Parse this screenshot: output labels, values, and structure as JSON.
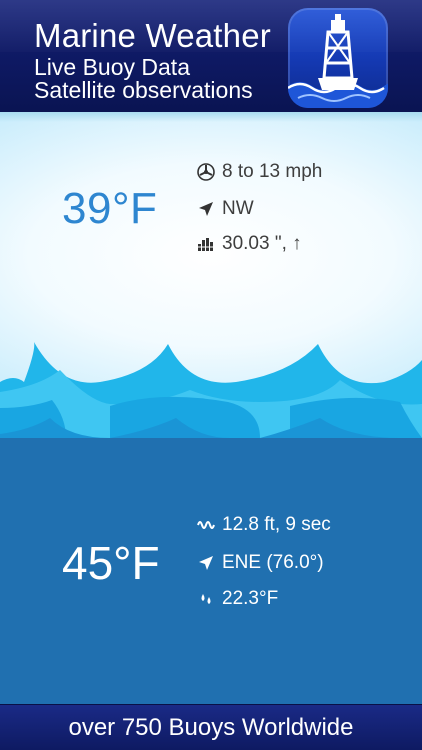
{
  "header": {
    "title": "Marine Weather",
    "subtitle1": "Live Buoy Data",
    "subtitle2": "Satellite observations",
    "app_icon": "buoy-icon"
  },
  "air": {
    "temperature": "39°F",
    "wind_speed": "8 to 13 mph",
    "wind_direction": "NW",
    "pressure": "30.03 \", ↑",
    "icons": [
      "wind-gauge-icon",
      "direction-arrow-icon",
      "pressure-bars-icon"
    ]
  },
  "sea": {
    "temperature": "45°F",
    "wave": "12.8 ft, 9 sec",
    "wave_direction": "ENE (76.0°)",
    "dew_point": "22.3°F",
    "icons": [
      "wave-icon",
      "direction-arrow-icon",
      "droplets-icon"
    ]
  },
  "footer": {
    "text": "over 750 Buoys Worldwide"
  },
  "colors": {
    "header_bg": "#0f1a66",
    "sky_text": "#2e86d0",
    "sea_bg": "#2070b0",
    "wave_light": "#28c4f0",
    "wave_dark": "#1590d6",
    "footer_bg": "#14207a"
  }
}
